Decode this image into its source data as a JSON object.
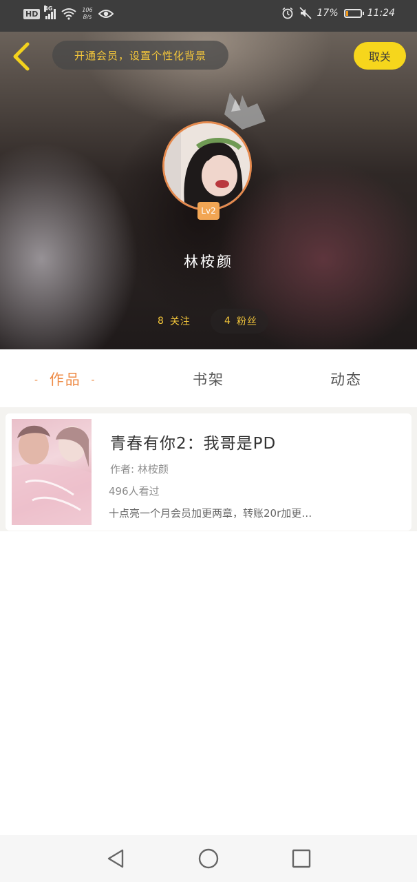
{
  "status_bar": {
    "hd": "HD",
    "network": "4G",
    "speed_value": "106",
    "speed_unit": "B/s",
    "battery_percent": "17%",
    "battery_level": 0.17,
    "time": "11:24"
  },
  "header": {
    "vip_banner": "开通会员，设置个性化背景",
    "cancel_label": "取关",
    "level": "Lv2",
    "username": "林桉颜",
    "following_count": "8",
    "following_label": "关注",
    "fans_count": "4",
    "fans_label": "粉丝"
  },
  "tabs": {
    "works": "作品",
    "works_dash": "-",
    "shelf": "书架",
    "feed": "动态"
  },
  "book": {
    "title": "青春有你2：我哥是PD",
    "author": "作者: 林桉颜",
    "views": "496人看过",
    "description": "十点亮一个月会员加更两章，转账20r加更…"
  },
  "colors": {
    "accent_orange": "#ee8a44",
    "gold": "#f2c53a",
    "cancel_yellow": "#f6d61c"
  }
}
